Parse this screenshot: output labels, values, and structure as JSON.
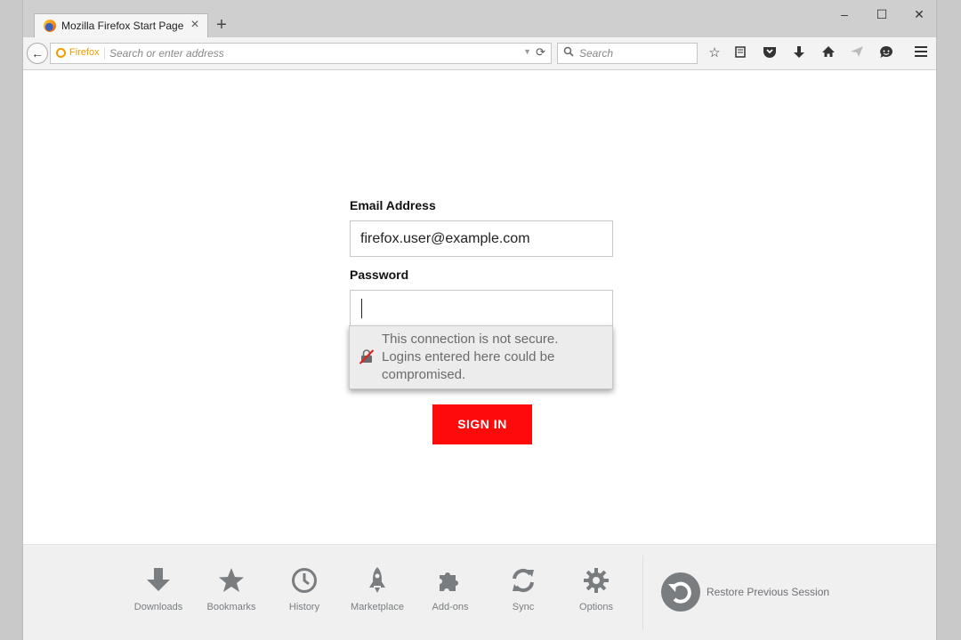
{
  "browser": {
    "tab_title": "Mozilla Firefox Start Page",
    "identity_label": "Firefox",
    "url_placeholder": "Search or enter address",
    "search_placeholder": "Search"
  },
  "form": {
    "email_label": "Email Address",
    "email_value": "firefox.user@example.com",
    "password_label": "Password",
    "password_value": "",
    "signin_label": "SIGN IN"
  },
  "insecure_popup": {
    "lines": [
      "This connection is not secure.",
      "Logins entered here could be",
      "compromised."
    ]
  },
  "launcher": {
    "items": [
      {
        "label": "Downloads",
        "icon": "download-icon"
      },
      {
        "label": "Bookmarks",
        "icon": "bookmark-star-icon"
      },
      {
        "label": "History",
        "icon": "clock-icon"
      },
      {
        "label": "Marketplace",
        "icon": "rocket-icon"
      },
      {
        "label": "Add-ons",
        "icon": "puzzle-icon"
      },
      {
        "label": "Sync",
        "icon": "sync-icon"
      },
      {
        "label": "Options",
        "icon": "gear-icon"
      }
    ],
    "restore_label": "Restore Previous Session"
  },
  "colors": {
    "signin_bg": "#ff0a0a",
    "firefox_orange": "#f29c00",
    "launcher_icon": "#7a7d80"
  }
}
